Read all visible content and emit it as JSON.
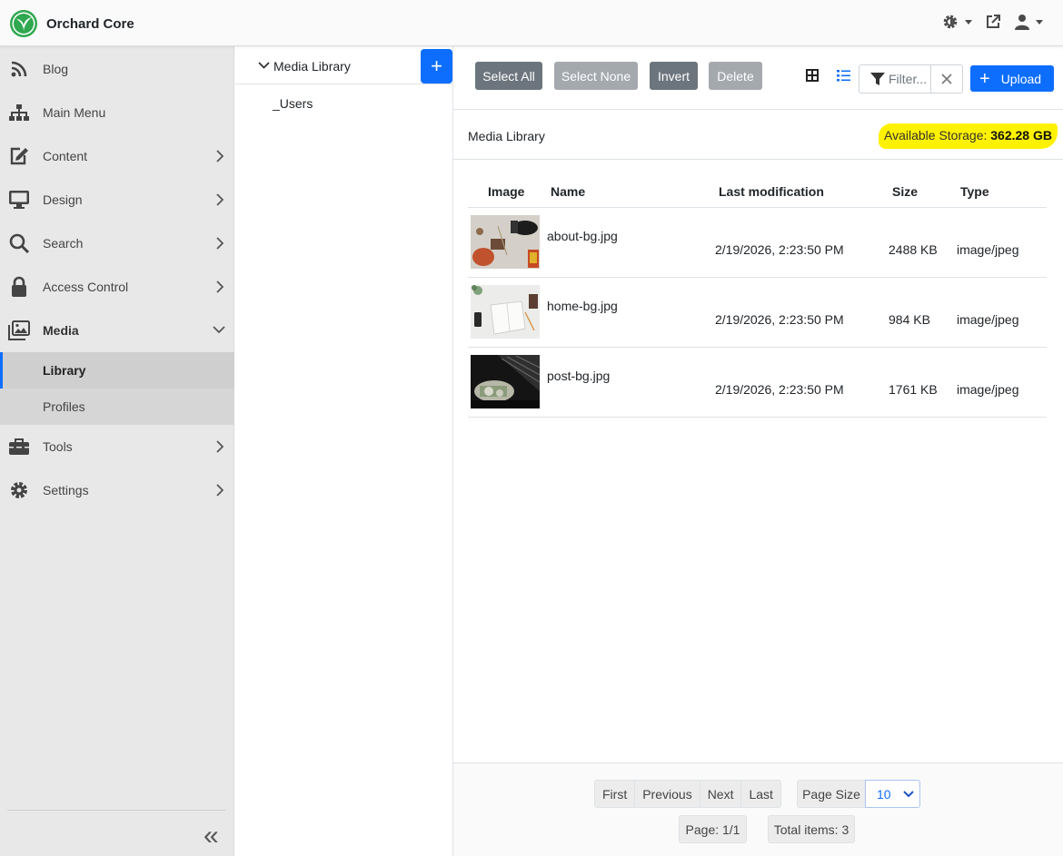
{
  "app": {
    "name": "Orchard Core"
  },
  "topbar": {
    "icons": [
      "theme-gear-icon",
      "external-link-icon",
      "user-icon"
    ]
  },
  "sidebar": {
    "items": [
      {
        "label": "Blog",
        "icon": "rss-icon",
        "has_children": false
      },
      {
        "label": "Main Menu",
        "icon": "sitemap-icon",
        "has_children": false
      },
      {
        "label": "Content",
        "icon": "edit-icon",
        "has_children": true
      },
      {
        "label": "Design",
        "icon": "monitor-icon",
        "has_children": true
      },
      {
        "label": "Search",
        "icon": "search-icon",
        "has_children": true
      },
      {
        "label": "Access Control",
        "icon": "lock-icon",
        "has_children": true
      },
      {
        "label": "Media",
        "icon": "images-icon",
        "has_children": true,
        "expanded": true
      },
      {
        "label": "Tools",
        "icon": "toolbox-icon",
        "has_children": true
      },
      {
        "label": "Settings",
        "icon": "gear-icon",
        "has_children": true
      }
    ],
    "media_children": [
      {
        "label": "Library",
        "active": true
      },
      {
        "label": "Profiles",
        "active": false
      }
    ],
    "collapse_symbol": "«"
  },
  "tree": {
    "root_label": "Media Library",
    "add_symbol": "+",
    "folders": [
      "_Users"
    ]
  },
  "toolbar": {
    "select_all": "Select All",
    "select_none": "Select None",
    "invert": "Invert",
    "delete": "Delete",
    "filter_placeholder": "Filter...",
    "upload": "Upload"
  },
  "path": {
    "label": "Media Library",
    "storage_label": "Available Storage:",
    "storage_value": "362.28 GB"
  },
  "table": {
    "headers": {
      "image": "Image",
      "name": "Name",
      "modified": "Last modification",
      "size": "Size",
      "type": "Type"
    },
    "rows": [
      {
        "name": "about-bg.jpg",
        "modified": "2/19/2026, 2:23:50 PM",
        "size": "2488 KB",
        "type": "image/jpeg"
      },
      {
        "name": "home-bg.jpg",
        "modified": "2/19/2026, 2:23:50 PM",
        "size": "984 KB",
        "type": "image/jpeg"
      },
      {
        "name": "post-bg.jpg",
        "modified": "2/19/2026, 2:23:50 PM",
        "size": "1761 KB",
        "type": "image/jpeg"
      }
    ]
  },
  "pager": {
    "first": "First",
    "previous": "Previous",
    "next": "Next",
    "last": "Last",
    "page_size_label": "Page Size",
    "page_size_value": "10",
    "page_info": "Page: 1/1",
    "total_items": "Total items: 3"
  },
  "colors": {
    "primary": "#0d6efd",
    "highlight": "#fff200",
    "sidebar_bg": "#e8e8e8",
    "brand_green": "#2fa84f"
  }
}
